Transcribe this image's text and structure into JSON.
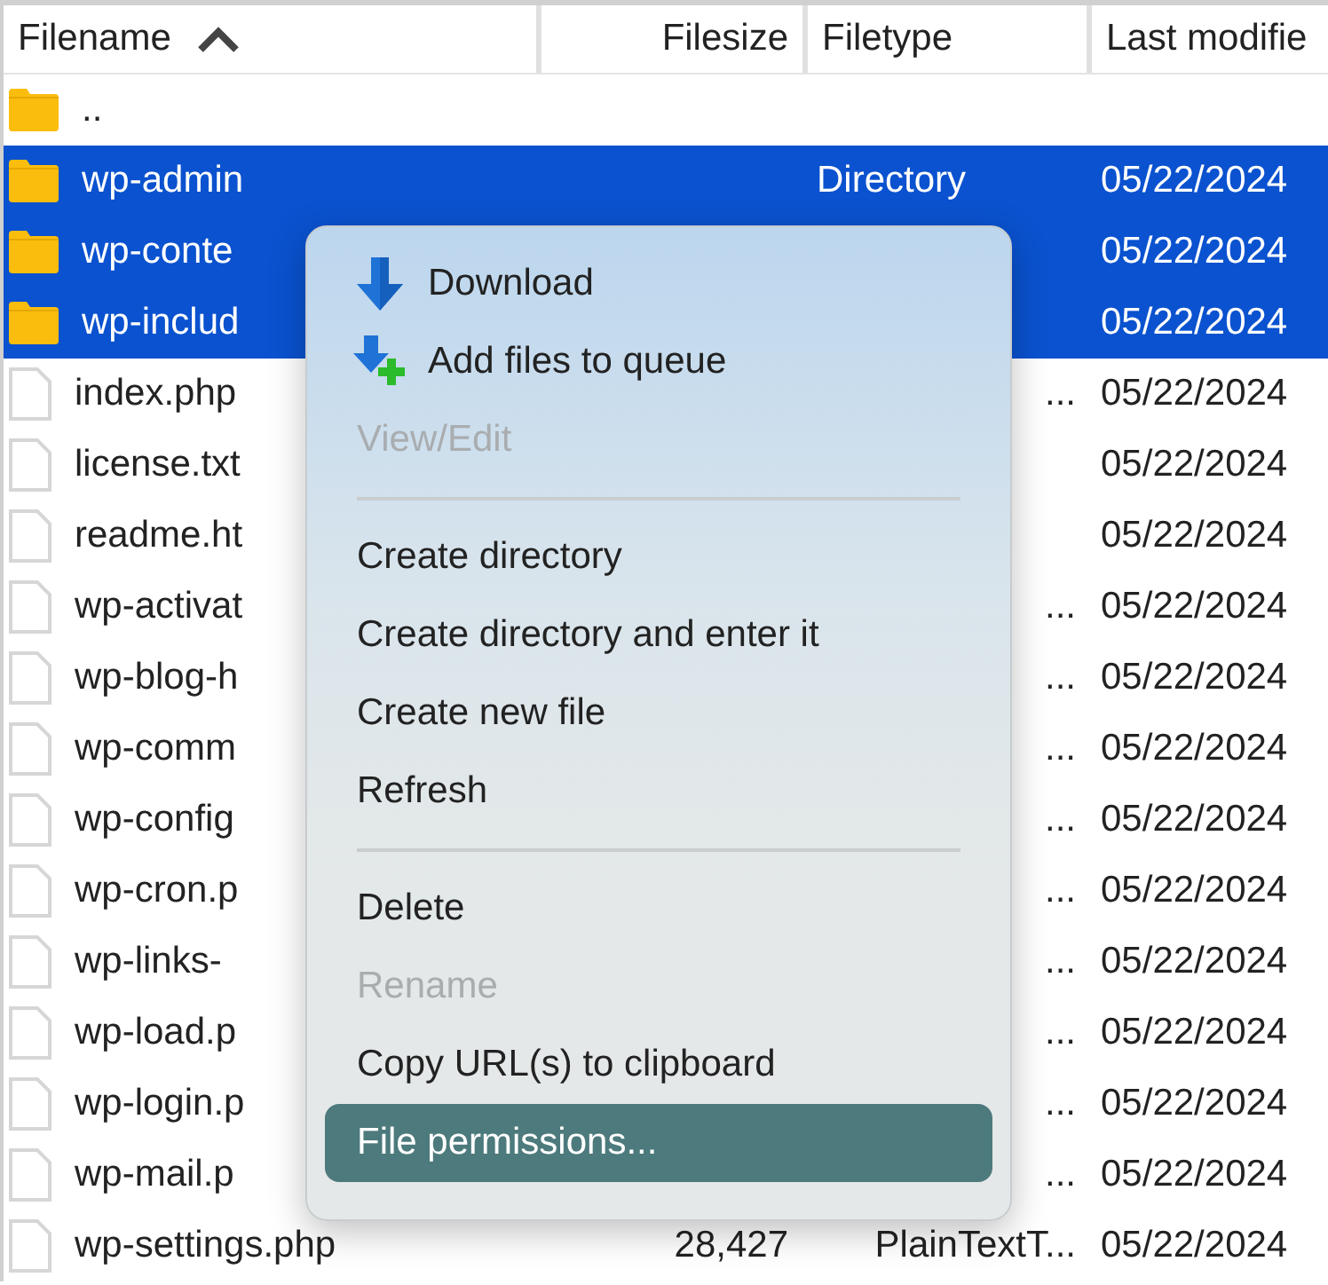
{
  "columns": [
    {
      "label": "Filename",
      "sorted": true
    },
    {
      "label": "Filesize",
      "sorted": false
    },
    {
      "label": "Filetype",
      "sorted": false
    },
    {
      "label": "Last modifie",
      "sorted": false
    }
  ],
  "rows": [
    {
      "kind": "folder",
      "selected": false,
      "name": ".."
    },
    {
      "kind": "folder",
      "selected": true,
      "name": "wp-admin",
      "type": "Directory",
      "date": "05/22/2024"
    },
    {
      "kind": "folder",
      "selected": true,
      "name": "wp-conte",
      "date": "05/22/2024"
    },
    {
      "kind": "folder",
      "selected": true,
      "name": "wp-includ",
      "date": "05/22/2024"
    },
    {
      "kind": "file",
      "selected": false,
      "name": "index.php",
      "type": "...",
      "date": "05/22/2024"
    },
    {
      "kind": "file",
      "selected": false,
      "name": "license.txt",
      "date": "05/22/2024"
    },
    {
      "kind": "file",
      "selected": false,
      "name": "readme.ht",
      "date": "05/22/2024"
    },
    {
      "kind": "file",
      "selected": false,
      "name": "wp-activat",
      "type": "...",
      "date": "05/22/2024"
    },
    {
      "kind": "file",
      "selected": false,
      "name": "wp-blog-h",
      "type": "...",
      "date": "05/22/2024"
    },
    {
      "kind": "file",
      "selected": false,
      "name": "wp-comm",
      "type": "...",
      "date": "05/22/2024"
    },
    {
      "kind": "file",
      "selected": false,
      "name": "wp-config",
      "type": "...",
      "date": "05/22/2024"
    },
    {
      "kind": "file",
      "selected": false,
      "name": "wp-cron.p",
      "type": "...",
      "date": "05/22/2024"
    },
    {
      "kind": "file",
      "selected": false,
      "name": "wp-links-",
      "type": "...",
      "date": "05/22/2024"
    },
    {
      "kind": "file",
      "selected": false,
      "name": "wp-load.p",
      "type": "...",
      "date": "05/22/2024"
    },
    {
      "kind": "file",
      "selected": false,
      "name": "wp-login.p",
      "type": "...",
      "date": "05/22/2024"
    },
    {
      "kind": "file",
      "selected": false,
      "name": "wp-mail.p",
      "type": "...",
      "date": "05/22/2024"
    },
    {
      "kind": "file",
      "selected": false,
      "name": "wp-settings.php",
      "size": "28,427",
      "type": "PlainTextT...",
      "date": "05/22/2024"
    }
  ],
  "context_menu": [
    {
      "kind": "download",
      "label": "Download",
      "disabled": false,
      "selected": false
    },
    {
      "kind": "queue",
      "label": "Add files to queue",
      "disabled": false,
      "selected": false
    },
    {
      "kind": "item",
      "label": "View/Edit",
      "disabled": true,
      "selected": false
    },
    {
      "kind": "separator"
    },
    {
      "kind": "item",
      "label": "Create directory",
      "disabled": false,
      "selected": false
    },
    {
      "kind": "item",
      "label": "Create directory and enter it",
      "disabled": false,
      "selected": false
    },
    {
      "kind": "item",
      "label": "Create new file",
      "disabled": false,
      "selected": false
    },
    {
      "kind": "item",
      "label": "Refresh",
      "disabled": false,
      "selected": false
    },
    {
      "kind": "separator"
    },
    {
      "kind": "item",
      "label": "Delete",
      "disabled": false,
      "selected": false
    },
    {
      "kind": "item",
      "label": "Rename",
      "disabled": true,
      "selected": false
    },
    {
      "kind": "item",
      "label": "Copy URL(s) to clipboard",
      "disabled": false,
      "selected": false
    },
    {
      "kind": "item",
      "label": "File permissions...",
      "disabled": false,
      "selected": true
    }
  ]
}
